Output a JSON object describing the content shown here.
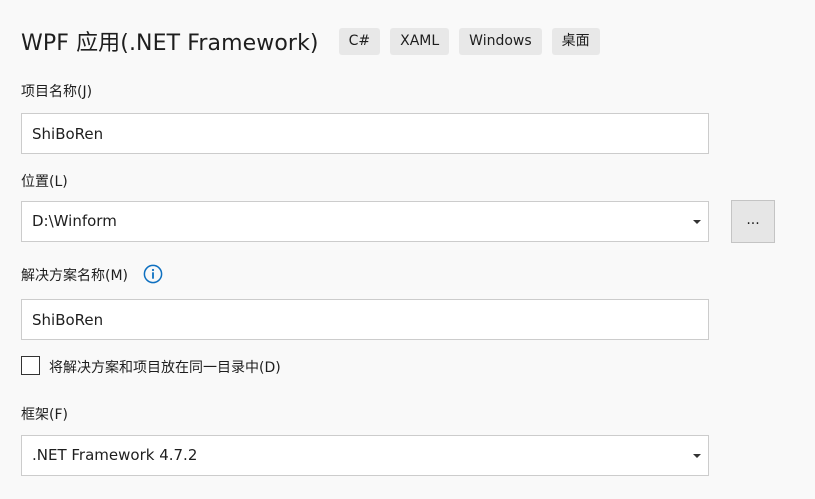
{
  "header": {
    "title": "WPF 应用(.NET Framework)",
    "tags": [
      "C#",
      "XAML",
      "Windows",
      "桌面"
    ]
  },
  "project_name": {
    "label": "项目名称(J)",
    "value": "ShiBoRen"
  },
  "location": {
    "label": "位置(L)",
    "value": "D:\\Winform",
    "browse_label": "..."
  },
  "solution_name": {
    "label": "解决方案名称(M)",
    "value": "ShiBoRen"
  },
  "same_dir": {
    "label": "将解决方案和项目放在同一目录中(D)",
    "checked": false
  },
  "framework": {
    "label": "框架(F)",
    "value": ".NET Framework 4.7.2"
  },
  "colors": {
    "background": "#f9f9f9",
    "tag_background": "#e8e8e8",
    "info_icon": "#0e70c0",
    "field_border": "#cccccc"
  }
}
